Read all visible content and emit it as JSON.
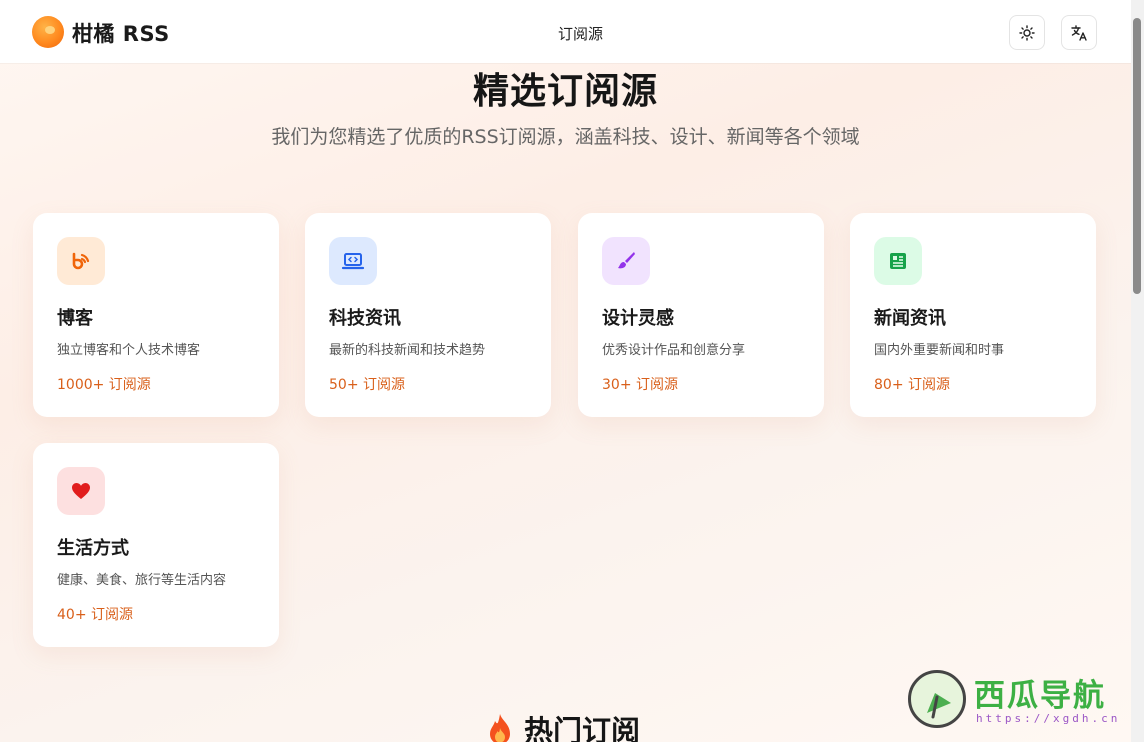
{
  "header": {
    "brand": "柑橘 RSS",
    "nav_link": "订阅源",
    "theme_icon": "sun-icon",
    "lang_icon": "translate-icon"
  },
  "hero": {
    "title": "精选订阅源",
    "subtitle": "我们为您精选了优质的RSS订阅源，涵盖科技、设计、新闻等各个领域"
  },
  "categories": [
    {
      "name": "博客",
      "desc": "独立博客和个人技术博客",
      "count": "1000+ 订阅源",
      "icon": "rss-blog-icon",
      "icon_color": "#f0650a",
      "icon_bg": "#ffead6"
    },
    {
      "name": "科技资讯",
      "desc": "最新的科技新闻和技术趋势",
      "count": "50+ 订阅源",
      "icon": "laptop-code-icon",
      "icon_color": "#2563eb",
      "icon_bg": "#dde9fe"
    },
    {
      "name": "设计灵感",
      "desc": "优秀设计作品和创意分享",
      "count": "30+ 订阅源",
      "icon": "paintbrush-icon",
      "icon_color": "#9333ea",
      "icon_bg": "#f1e3fe"
    },
    {
      "name": "新闻资讯",
      "desc": "国内外重要新闻和时事",
      "count": "80+ 订阅源",
      "icon": "newspaper-icon",
      "icon_color": "#16a34a",
      "icon_bg": "#dcfbe6"
    },
    {
      "name": "生活方式",
      "desc": "健康、美食、旅行等生活内容",
      "count": "40+ 订阅源",
      "icon": "heart-icon",
      "icon_color": "#e11d1d",
      "icon_bg": "#fde0e0"
    }
  ],
  "hot": {
    "title": "热门订阅",
    "icon": "fire-icon"
  },
  "watermark": {
    "brand": "西瓜导航",
    "url": "https://xgdh.cn"
  },
  "colors": {
    "accent": "#d9601b",
    "brand_orange": "#ff8a1f"
  }
}
